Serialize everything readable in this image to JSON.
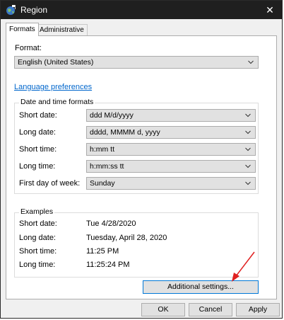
{
  "window": {
    "title": "Region",
    "close_glyph": "✕"
  },
  "tabs": [
    {
      "label": "Formats",
      "active": true
    },
    {
      "label": "Administrative",
      "active": false
    }
  ],
  "format": {
    "label": "Format:",
    "value": "English (United States)"
  },
  "language_link": "Language preferences",
  "date_time_formats": {
    "legend": "Date and time formats",
    "rows": [
      {
        "label": "Short date:",
        "value": "ddd M/d/yyyy"
      },
      {
        "label": "Long date:",
        "value": "dddd, MMMM d, yyyy"
      },
      {
        "label": "Short time:",
        "value": "h:mm tt"
      },
      {
        "label": "Long time:",
        "value": "h:mm:ss tt"
      },
      {
        "label": "First day of week:",
        "value": "Sunday"
      }
    ]
  },
  "examples": {
    "legend": "Examples",
    "rows": [
      {
        "label": "Short date:",
        "value": "Tue 4/28/2020"
      },
      {
        "label": "Long date:",
        "value": "Tuesday, April 28, 2020"
      },
      {
        "label": "Short time:",
        "value": "11:25 PM"
      },
      {
        "label": "Long time:",
        "value": "11:25:24 PM"
      }
    ]
  },
  "buttons": {
    "additional": "Additional settings...",
    "ok": "OK",
    "cancel": "Cancel",
    "apply": "Apply"
  },
  "icons": {
    "app": "region-globe-icon",
    "dropdown": "chevron-down-icon",
    "annotation": "red-arrow-icon"
  },
  "colors": {
    "titlebar": "#1f1f1f",
    "link": "#0066cc",
    "focus_border": "#0078d7",
    "annotation_arrow": "#e02020"
  }
}
